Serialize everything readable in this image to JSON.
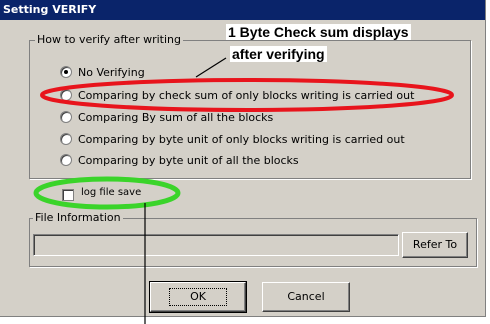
{
  "window": {
    "title": "Setting VERIFY"
  },
  "verify_group": {
    "label": "How to verify after writing",
    "options": [
      {
        "label": "No Verifying",
        "selected": true
      },
      {
        "label": "Comparing by check sum of only blocks writing is carried out",
        "selected": false
      },
      {
        "label": "Comparing By sum of all the blocks",
        "selected": false
      },
      {
        "label": "Comparing by byte unit of only blocks writing is carried out",
        "selected": false
      },
      {
        "label": "Comparing by byte unit of all the blocks",
        "selected": false
      }
    ]
  },
  "log_checkbox": {
    "label": "log file save",
    "checked": false
  },
  "file_info": {
    "label": "File Information",
    "path_value": "",
    "refer_button": "Refer To"
  },
  "buttons": {
    "ok": "OK",
    "cancel": "Cancel"
  },
  "annotation": {
    "line1": "1 Byte Check sum displays",
    "line2": "after verifying"
  },
  "colors": {
    "titlebar": "#0a246a",
    "highlight_red": "#e8141c",
    "highlight_green": "#3ad42a",
    "dialog_face": "#d4d0c8"
  }
}
